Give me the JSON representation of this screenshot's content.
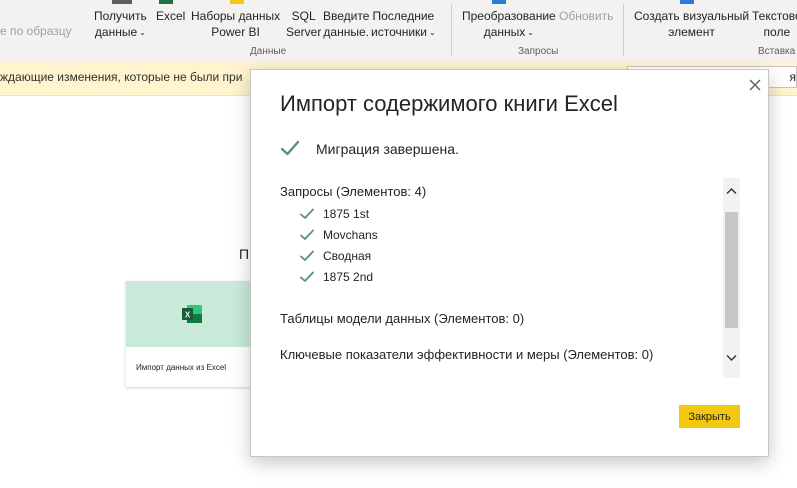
{
  "ribbon": {
    "partial_left": "е по образцу",
    "get_data": [
      "Получить",
      "данные"
    ],
    "excel": "Excel",
    "powerbi_datasets": [
      "Наборы данных",
      "Power BI"
    ],
    "sql": [
      "SQL",
      "Server"
    ],
    "enter_data": [
      "Введите",
      "данные."
    ],
    "recent_sources": [
      "Последние",
      "источники"
    ],
    "group_data": "Данные",
    "transform": [
      "Преобразование",
      "данных"
    ],
    "refresh": "Обновить",
    "group_queries": "Запросы",
    "visual": [
      "Создать визуальный",
      "элемент"
    ],
    "textbox": [
      "Текстово",
      "поле"
    ],
    "group_insert": "Вставка"
  },
  "notice": {
    "text": "ждающие изменения, которые не были при",
    "button_text": "я"
  },
  "canvas": {
    "partial_letter": "П",
    "card_label": "Импорт данных из Excel"
  },
  "dialog": {
    "title": "Импорт содержимого книги Excel",
    "status": "Миграция завершена.",
    "queries_header": "Запросы (Элементов: 4)",
    "queries": [
      "1875 1st",
      "Movchans",
      "Сводная",
      "1875 2nd"
    ],
    "tables_header": "Таблицы модели данных (Элементов: 0)",
    "kpi_header": "Ключевые показатели эффективности и меры (Элементов: 0)",
    "close_button": "Закрыть"
  },
  "colors": {
    "accent": "#f2c811",
    "check": "#5b8f80",
    "excel_green": "#1e7145",
    "notice_bg": "#fff4ce"
  }
}
